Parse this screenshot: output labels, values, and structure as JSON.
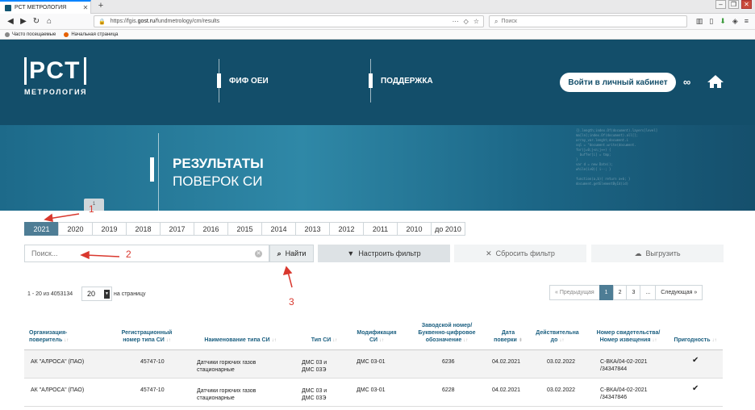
{
  "browser": {
    "tab_title": "РСТ МЕТРОЛОГИЯ",
    "url_prefix": "https://fgis.",
    "url_domain": "gost.ru",
    "url_path": "/fundmetrology/cm/results",
    "search_placeholder": "Поиск",
    "bookmarks": [
      "Часто посещаемые",
      "Начальная страница"
    ]
  },
  "header": {
    "logo_text": "РСТ",
    "logo_sub": "МЕТРОЛОГИЯ",
    "nav": [
      "ФИФ ОЕИ",
      "ПОДДЕРЖКА"
    ],
    "cabinet_button": "Войти в личный кабинет"
  },
  "banner": {
    "title_line1": "РЕЗУЛЬТАТЫ",
    "title_line2": "ПОВЕРОК СИ",
    "tab_marker": "1"
  },
  "years": [
    "2021",
    "2020",
    "2019",
    "2018",
    "2017",
    "2016",
    "2015",
    "2014",
    "2013",
    "2012",
    "2011",
    "2010",
    "до 2010"
  ],
  "active_year": "2021",
  "search": {
    "placeholder": "Поиск...",
    "find_button": "Найти",
    "filter_button": "Настроить фильтр",
    "reset_button": "Сбросить фильтр",
    "export_button": "Выгрузить"
  },
  "annotations": [
    "1",
    "2",
    "3"
  ],
  "pagination": {
    "count_text": "1 - 20 из 4053134",
    "per_page_value": "20",
    "per_page_label": "на страницу",
    "prev": "« Предыдущая",
    "pages": [
      "1",
      "2",
      "3",
      "..."
    ],
    "next": "Следующая »"
  },
  "table": {
    "columns": [
      "Организация-поверитель",
      "Регистрационный номер типа СИ",
      "Наименование типа СИ",
      "Тип СИ",
      "Модификация СИ",
      "Заводской номер/ Буквенно-цифровое обозначение",
      "Дата поверки",
      "Действительна до",
      "Номер свидетельства/ Номер извещения",
      "Пригодность"
    ],
    "rows": [
      {
        "org": "АК \"АЛРОСА\" (ПАО)",
        "reg": "45747-10",
        "name": "Датчики горючих газов стационарные",
        "type": "ДМС 03 и ДМС 03Э",
        "mod": "ДМС 03-01",
        "serial": "6236",
        "date": "04.02.2021",
        "valid": "03.02.2022",
        "cert": "С-ВКА/04-02-2021 /34347844",
        "ok": "✔"
      },
      {
        "org": "АК \"АЛРОСА\" (ПАО)",
        "reg": "45747-10",
        "name": "Датчики горючих газов стационарные",
        "type": "ДМС 03 и ДМС 03Э",
        "mod": "ДМС 03-01",
        "serial": "6228",
        "date": "04.02.2021",
        "valid": "03.02.2022",
        "cert": "С-ВКА/04-02-2021 /34347846",
        "ok": "✔"
      }
    ]
  },
  "colors": {
    "header_bg": "#134e6a",
    "accent": "#4e7d95",
    "link": "#1b5f80",
    "annotation": "#d9382e"
  }
}
